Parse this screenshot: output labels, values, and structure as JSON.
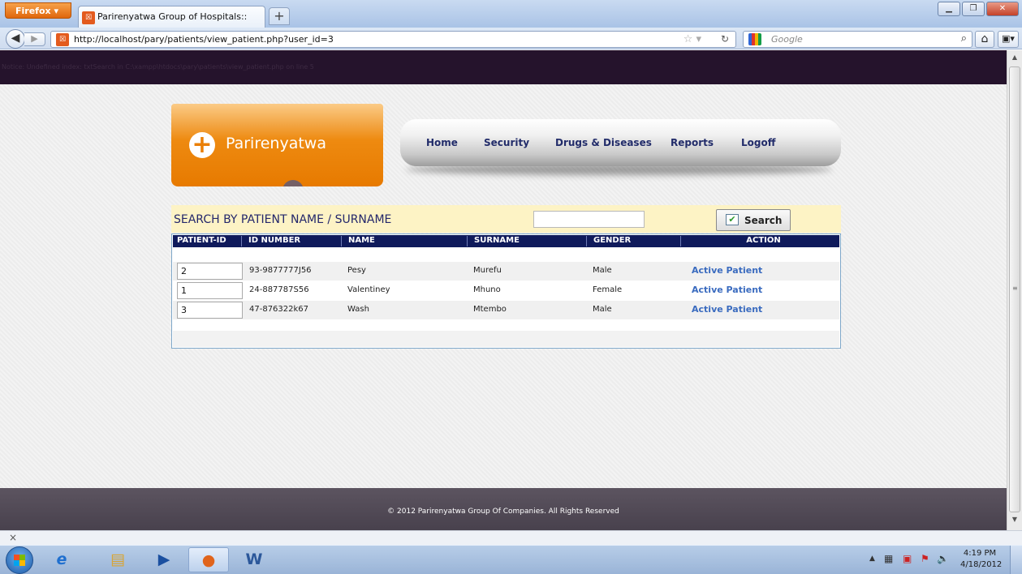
{
  "browser": {
    "menu_button": "Firefox ▾",
    "tab_title": "Parirenyatwa Group of Hospitals::",
    "tab_favicon": "xampp-icon",
    "url": "http://localhost/pary/patients/view_patient.php?user_id=3",
    "search_engine_placeholder": "Google",
    "new_tab": "+"
  },
  "notice": "Notice: Undefined index: txtSearch in C:\\xampp\\htdocs\\pary\\patients\\view_patient.php on line 5",
  "logo": {
    "text": "Parirenyatwa",
    "icon": "plus-icon",
    "icon_glyph": "+"
  },
  "nav": {
    "items": [
      "Home",
      "Security",
      "Drugs & Diseases",
      "Reports",
      "Logoff"
    ]
  },
  "search": {
    "label": "SEARCH BY PATIENT NAME / SURNAME",
    "value": "",
    "button_label": "Search"
  },
  "table": {
    "columns": [
      "PATIENT-ID",
      "ID NUMBER",
      "NAME",
      "SURNAME",
      "GENDER",
      "ACTION"
    ],
    "rows": [
      {
        "patient_id": "2",
        "id_number": "93-9877777J56",
        "name": "Pesy",
        "surname": "Murefu",
        "gender": "Male",
        "action": "Active Patient"
      },
      {
        "patient_id": "1",
        "id_number": "24-887787S56",
        "name": "Valentiney",
        "surname": "Mhuno",
        "gender": "Female",
        "action": "Active Patient"
      },
      {
        "patient_id": "3",
        "id_number": "47-876322k67",
        "name": "Wash",
        "surname": "Mtembo",
        "gender": "Male",
        "action": "Active Patient"
      }
    ]
  },
  "footer": {
    "text": "© 2012 Parirenyatwa Group Of Companies. All Rights Reserved"
  },
  "taskbar": {
    "time": "4:19 PM",
    "date": "4/18/2012"
  },
  "colors": {
    "header_bar": "#25132c",
    "logo_orange": "#ee8a10",
    "table_header": "#0f1a5b",
    "search_row_bg": "#fdf3c5",
    "link_blue": "#3a6bbf",
    "footer_bg": "#48414d"
  }
}
